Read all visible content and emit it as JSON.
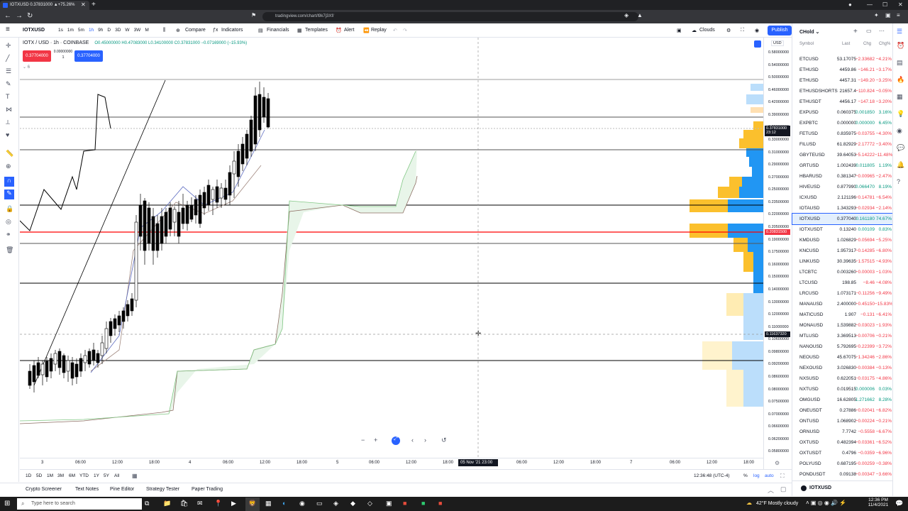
{
  "browser": {
    "tab_title": "IOTXUSD 0.37831000 ▲+75.26%",
    "url": "tradingview.com/chart/l9k7j3Xf/"
  },
  "toolbar": {
    "symbol": "IOTXUSD",
    "intervals": [
      "1s",
      "1m",
      "5m",
      "1h",
      "9h",
      "D",
      "3D",
      "W",
      "3W",
      "M"
    ],
    "compare": "Compare",
    "indicators": "Indicators",
    "financials": "Financials",
    "templates": "Templates",
    "alert": "Alert",
    "replay": "Replay",
    "layout_name": "Clouds",
    "publish": "Publish"
  },
  "legend": {
    "title": "IOTX / USD · 1h · COINBASE",
    "ohlc": "O0.45000000 H0.47083000 L0.34100000 C0.37831000 −0.07169000 (−15.93%)",
    "sell_price": "0.37704000",
    "buy_price": "0.37704000",
    "spread_top": "0.00000000",
    "spread_bottom": "1",
    "indicator_count": "6"
  },
  "price_axis": {
    "currency": "USD",
    "ticks": [
      "0.58000000",
      "0.54000000",
      "0.50000000",
      "0.46000000",
      "0.42000000",
      "0.39000000",
      "0.36000000",
      "0.33000000",
      "0.31000000",
      "0.29000000",
      "0.27000000",
      "0.25000000",
      "0.23500000",
      "0.22000000",
      "0.20500000",
      "0.19000000",
      "0.17500000",
      "0.16000000",
      "0.15000000",
      "0.14000000",
      "0.13000000",
      "0.12000000",
      "0.11000000",
      "0.10600000",
      "0.09800000",
      "0.09200000",
      "0.08600000",
      "0.08000000",
      "0.07500000",
      "0.07000000",
      "0.06600000",
      "0.06200000",
      "0.05800000"
    ],
    "current_price": "0.37831000",
    "countdown": "23:12",
    "red_line_price": "0.20831500",
    "crosshair_price": "0.11637320"
  },
  "time_axis": {
    "ticks": [
      "3",
      "06:00",
      "12:00",
      "18:00",
      "4",
      "06:00",
      "12:00",
      "18:00",
      "5",
      "06:00",
      "12:00",
      "18:00",
      "06:00",
      "12:00",
      "18:00",
      "7",
      "06:00",
      "12:00",
      "18:00"
    ],
    "crosshair_label": "05 Nov '21  23:00"
  },
  "range_bar": {
    "ranges": [
      "1D",
      "5D",
      "1M",
      "3M",
      "6M",
      "YTD",
      "1Y",
      "5Y",
      "All"
    ],
    "clock": "12:36:48 (UTC-4)",
    "pct": "%",
    "log": "log",
    "auto": "auto"
  },
  "bottom_tabs": [
    "Crypto Screener",
    "Text Notes",
    "Pine Editor",
    "Strategy Tester",
    "Paper Trading"
  ],
  "watchlist": {
    "name": "CHold",
    "columns": [
      "Symbol",
      "Last",
      "Chg",
      "Chg%"
    ],
    "rows": [
      [
        "ETCUSD",
        "53.17075",
        "−2.33682",
        "−4.21%"
      ],
      [
        "ETHUSD",
        "4459.86",
        "−146.21",
        "−3.17%"
      ],
      [
        "ETHUSD",
        "4457.31",
        "−149.20",
        "−3.25%"
      ],
      [
        "ETHUSDSHORTS",
        "21657.4",
        "−110.824",
        "−0.05%"
      ],
      [
        "ETHUSDT",
        "4456.17",
        "−147.18",
        "−3.20%"
      ],
      [
        "EXPUSD",
        "0.060375",
        "0.001850",
        "3.16%"
      ],
      [
        "EXPBTC",
        "0.000000",
        "0.000000",
        "6.45%"
      ],
      [
        "FETUSD",
        "0.835975",
        "−0.03755",
        "−4.30%"
      ],
      [
        "FILUSD",
        "61.82929",
        "−2.17772",
        "−3.40%"
      ],
      [
        "GBYTEUSD",
        "39.64053",
        "−5.14222",
        "−11.48%"
      ],
      [
        "GRTUSD",
        "1.002439",
        "0.011805",
        "1.19%"
      ],
      [
        "HBARUSD",
        "0.381347",
        "−0.00965",
        "−2.47%"
      ],
      [
        "HIVEUSD",
        "0.877990",
        "0.066470",
        "8.19%"
      ],
      [
        "ICXUSD",
        "2.121196",
        "−0.14781",
        "−6.54%"
      ],
      [
        "IOTAUSD",
        "1.343293",
        "−0.02934",
        "−2.14%"
      ],
      [
        "IOTXUSD",
        "0.377040",
        "0.161180",
        "74.67%"
      ],
      [
        "IOTXUSDT",
        "0.13240",
        "0.00109",
        "0.83%"
      ],
      [
        "KMDUSD",
        "1.026829",
        "−0.05694",
        "−5.25%"
      ],
      [
        "KNCUSD",
        "1.957317",
        "−0.14285",
        "−6.80%"
      ],
      [
        "LINKUSD",
        "30.39635",
        "−1.57515",
        "−4.93%"
      ],
      [
        "LTCBTC",
        "0.003260",
        "−0.00003",
        "−1.03%"
      ],
      [
        "LTCUSD",
        "198.85",
        "−8.46",
        "−4.08%"
      ],
      [
        "LRCUSD",
        "1.073171",
        "−0.11256",
        "−9.49%"
      ],
      [
        "MANAUSD",
        "2.400000",
        "−0.45150",
        "−15.83%"
      ],
      [
        "MATICUSD",
        "1.907",
        "−0.131",
        "−6.41%"
      ],
      [
        "MONAUSD",
        "1.539882",
        "−0.03023",
        "−1.93%"
      ],
      [
        "MTLUSD",
        "3.369513",
        "−0.00706",
        "−0.21%"
      ],
      [
        "NANOUSD",
        "5.792695",
        "−0.22399",
        "−3.72%"
      ],
      [
        "NEOUSD",
        "45.67075",
        "−1.34246",
        "−2.86%"
      ],
      [
        "NEXOUSD",
        "3.026830",
        "−0.00384",
        "−0.13%"
      ],
      [
        "NXSUSD",
        "0.622051",
        "−0.03175",
        "−4.86%"
      ],
      [
        "NXTUSD",
        "0.019515",
        "0.000006",
        "0.03%"
      ],
      [
        "OMGUSD",
        "16.62805",
        "1.271662",
        "8.28%"
      ],
      [
        "ONEUSDT",
        "0.27886",
        "−0.02041",
        "−6.82%"
      ],
      [
        "ONTUSD",
        "1.068902",
        "−0.00224",
        "−0.21%"
      ],
      [
        "ORNUSD",
        "7.7742",
        "−0.5558",
        "−6.67%"
      ],
      [
        "OXTUSD",
        "0.482394",
        "−0.03361",
        "−6.52%"
      ],
      [
        "OXTUSDT",
        "0.4796",
        "−0.0359",
        "−6.96%"
      ],
      [
        "POLYUSD",
        "0.687195",
        "−0.00259",
        "−0.38%"
      ],
      [
        "PONDUSDT",
        "0.09138",
        "−0.00347",
        "−3.66%"
      ]
    ],
    "detail_symbol": "IOTXUSD"
  },
  "taskbar": {
    "search": "Type here to search",
    "weather": "42°F  Mostly cloudy",
    "time": "12:36 PM",
    "date": "11/4/2021"
  },
  "colors": {
    "accent": "#2962ff",
    "up": "#089981",
    "down": "#f23645",
    "red_line": "#ff0000"
  }
}
